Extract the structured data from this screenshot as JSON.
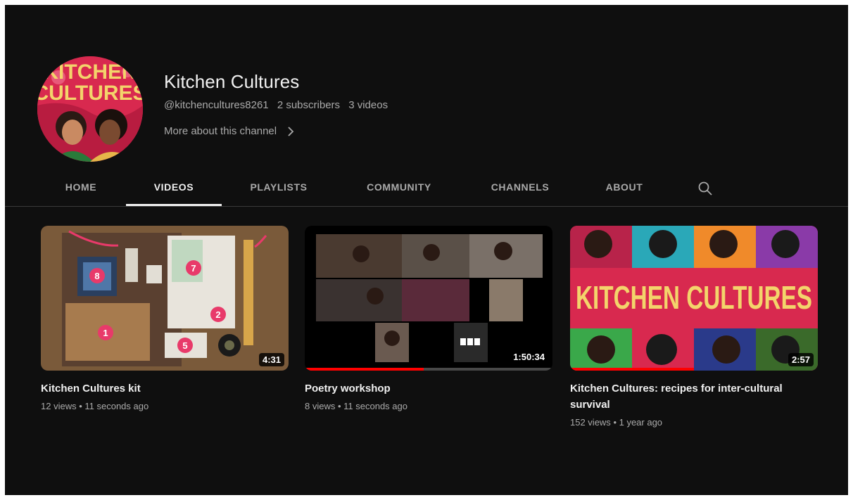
{
  "channel": {
    "name": "Kitchen Cultures",
    "handle": "@kitchencultures8261",
    "subscribers": "2 subscribers",
    "videos_count": "3 videos",
    "more_about": "More about this channel",
    "avatar_text_line1": "KITCHEN",
    "avatar_text_line2": "CULTURES"
  },
  "tabs": [
    {
      "label": "HOME",
      "active": false
    },
    {
      "label": "VIDEOS",
      "active": true
    },
    {
      "label": "PLAYLISTS",
      "active": false
    },
    {
      "label": "COMMUNITY",
      "active": false
    },
    {
      "label": "CHANNELS",
      "active": false
    },
    {
      "label": "ABOUT",
      "active": false
    }
  ],
  "videos": [
    {
      "title": "Kitchen Cultures kit",
      "views": "12 views",
      "age": "11 seconds ago",
      "duration": "4:31",
      "thumb_numbers": [
        "8",
        "7",
        "2",
        "1",
        "5"
      ],
      "watched_fraction": 0
    },
    {
      "title": "Poetry workshop",
      "views": "8 views",
      "age": "11 seconds ago",
      "duration": "1:50:34",
      "watched_fraction": 0.48
    },
    {
      "title": "Kitchen Cultures: recipes for inter-cultural survival",
      "views": "152 views",
      "age": "1 year ago",
      "duration": "2:57",
      "thumb_text": "KITCHEN CULTURES",
      "watched_fraction": 0.5
    }
  ],
  "colors": {
    "background": "#0f0f0f",
    "text_primary": "#f1f1f1",
    "text_secondary": "#aaaaaa",
    "progress": "#ff0000",
    "brand_pink": "#d8294f",
    "brand_yellow": "#f3d46b"
  },
  "icons": {
    "search": "search-icon",
    "chevron": "chevron-right-icon"
  }
}
